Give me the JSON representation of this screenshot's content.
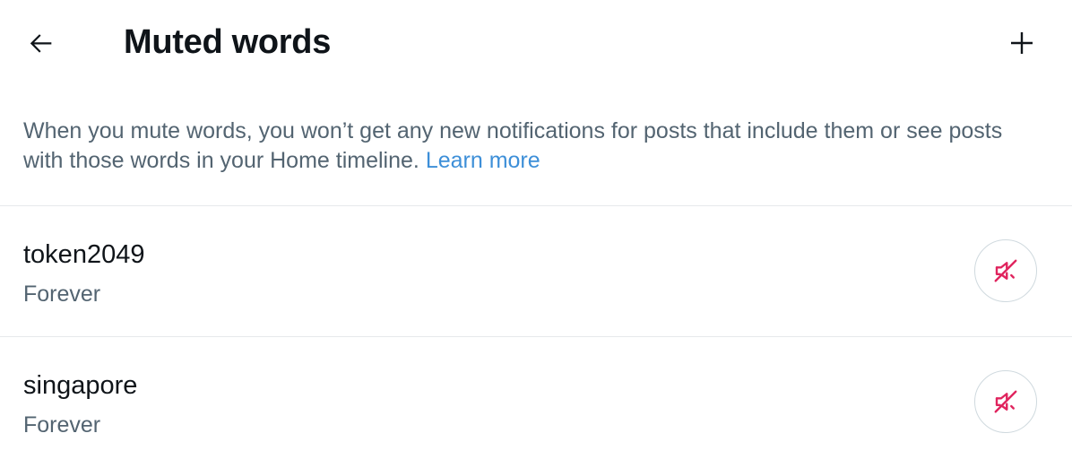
{
  "header": {
    "back_icon": "arrow-left-icon",
    "title": "Muted words",
    "add_icon": "plus-icon"
  },
  "description": {
    "text": "When you mute words, you won’t get any new notifications for posts that include them or see posts with those words in your Home timeline.",
    "link_text": "Learn more"
  },
  "colors": {
    "link": "#3d8fd8",
    "muted_icon": "#e0245e",
    "secondary_text": "#536471"
  },
  "muted_words": [
    {
      "word": "token2049",
      "duration": "Forever",
      "action_icon": "unmute-speaker-icon"
    },
    {
      "word": "singapore",
      "duration": "Forever",
      "action_icon": "unmute-speaker-icon"
    }
  ]
}
